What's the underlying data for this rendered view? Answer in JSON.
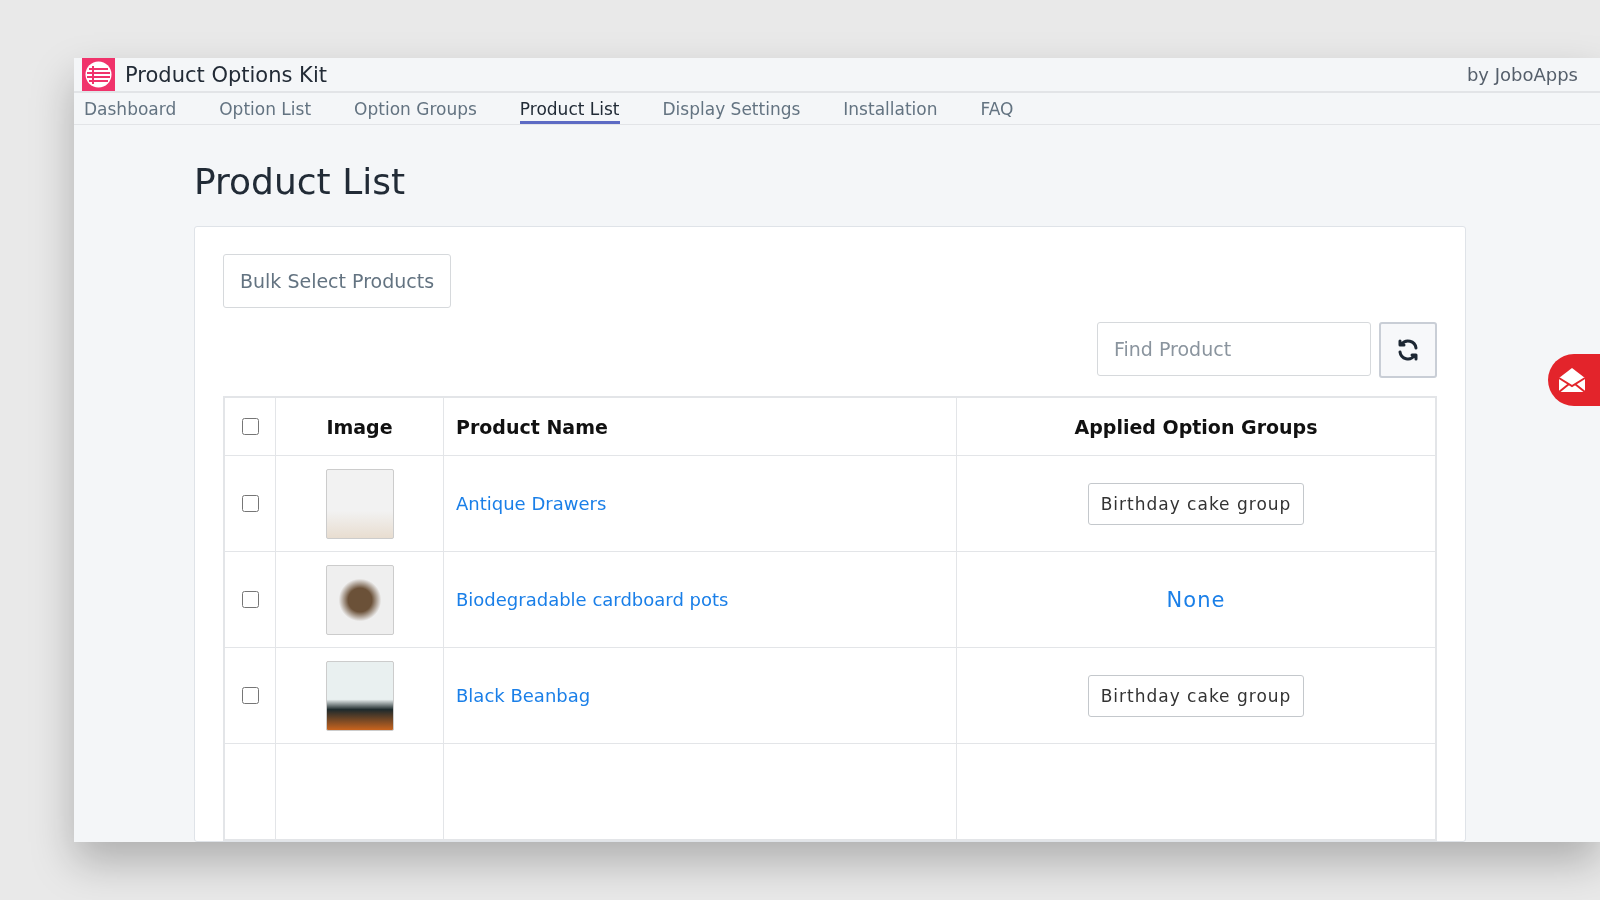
{
  "app": {
    "title": "Product Options Kit",
    "vendor": "by JoboApps"
  },
  "tabs": [
    {
      "label": "Dashboard",
      "selected": false
    },
    {
      "label": "Option List",
      "selected": false
    },
    {
      "label": "Option Groups",
      "selected": false
    },
    {
      "label": "Product List",
      "selected": true
    },
    {
      "label": "Display Settings",
      "selected": false
    },
    {
      "label": "Installation",
      "selected": false
    },
    {
      "label": "FAQ",
      "selected": false
    }
  ],
  "page_title": "Product List",
  "bulk_button": "Bulk Select Products",
  "search": {
    "placeholder": "Find Product"
  },
  "table": {
    "select_all_checked": false,
    "columns": [
      "Image",
      "Product Name",
      "Applied Option Groups"
    ],
    "rows": [
      {
        "checked": false,
        "name": "Antique Drawers",
        "group": {
          "kind": "tag",
          "label": "Birthday cake group"
        }
      },
      {
        "checked": false,
        "name": "Biodegradable cardboard pots",
        "group": {
          "kind": "none",
          "label": "None"
        }
      },
      {
        "checked": false,
        "name": "Black Beanbag",
        "group": {
          "kind": "tag",
          "label": "Birthday cake group"
        }
      }
    ]
  }
}
